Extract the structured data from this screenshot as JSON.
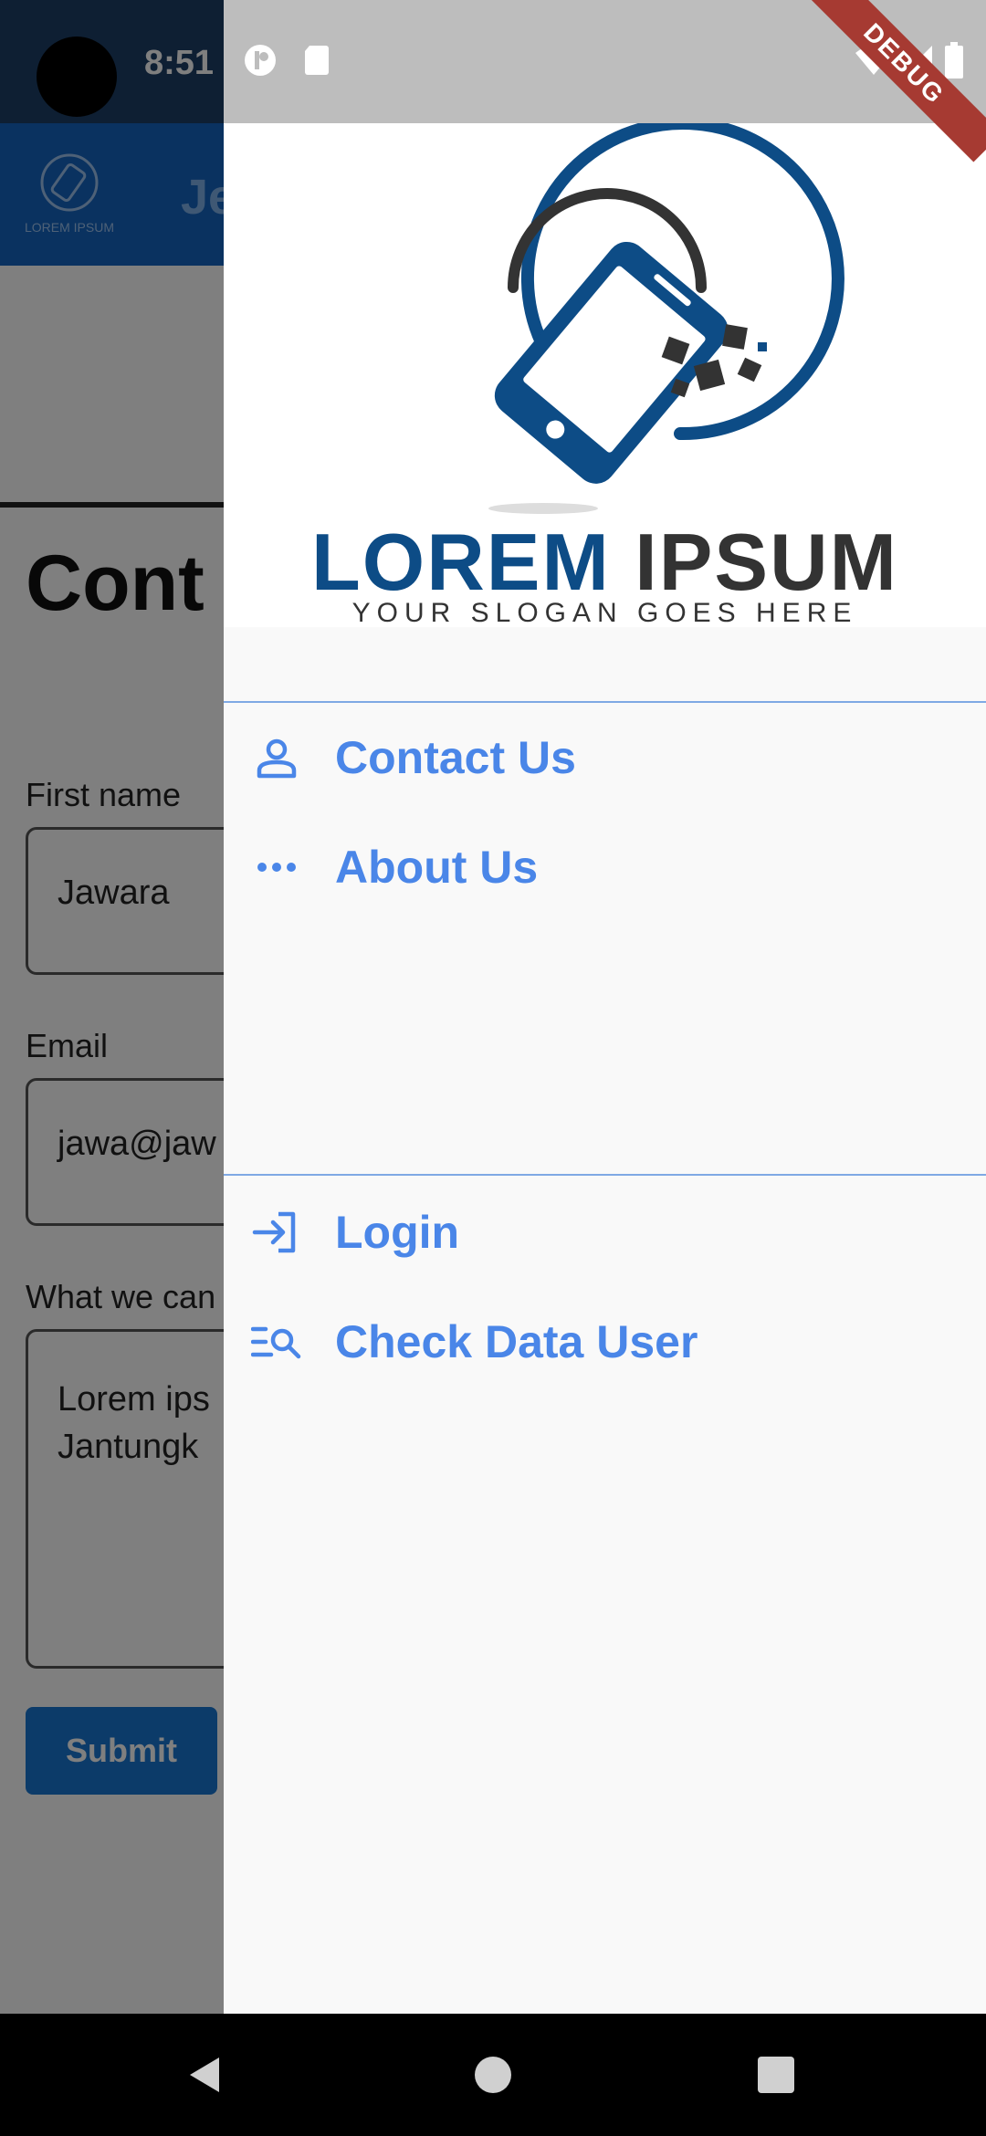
{
  "status_bar": {
    "time": "8:51"
  },
  "debug_banner": "DEBUG",
  "background_app": {
    "appbar_title": "Je",
    "logo_text": "LOREM IPSUM",
    "page_heading": "Cont",
    "fields": [
      {
        "label": "First name",
        "value": "Jawara"
      },
      {
        "label": "Email",
        "value": "jawa@jaw"
      }
    ],
    "textarea": {
      "label": "What we can",
      "line1": "Lorem ips",
      "line2": "Jantungk"
    },
    "submit_label": "Submit"
  },
  "drawer": {
    "brand": {
      "word1": "LOREM",
      "word2": "IPSUM",
      "slogan": "YOUR SLOGAN GOES HERE"
    },
    "items": [
      {
        "label": "Contact Us",
        "icon": "person-icon"
      },
      {
        "label": "About Us",
        "icon": "more-horiz-icon"
      },
      {
        "label": "Login",
        "icon": "login-icon"
      },
      {
        "label": "Check Data User",
        "icon": "manage-search-icon"
      }
    ]
  },
  "colors": {
    "accent": "#4a86e8",
    "brand_blue": "#0d4c86",
    "appbar": "#1565c0",
    "divider": "#7fa9e4"
  }
}
